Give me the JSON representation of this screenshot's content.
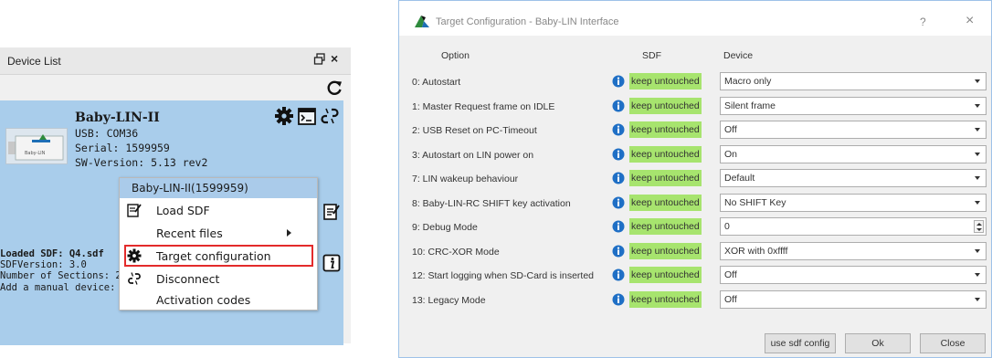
{
  "device_list": {
    "title": "Device List",
    "float_icon": "float-window-icon",
    "close_glyph": "×",
    "refresh_icon": "refresh-icon"
  },
  "device": {
    "name": "Baby-LIN-II",
    "usb": "USB: COM36",
    "serial": "Serial: 1599959",
    "sw_version": "SW-Version: 5.13 rev2",
    "thumbnail_label": "Baby-LIN",
    "card_color": "#a9cdeb"
  },
  "sdf": {
    "loaded": "Loaded SDF: Q4.sdf",
    "version": "SDFVersion: 3.0",
    "sections": "Number of Sections: 2",
    "add_manual": "Add a manual device:"
  },
  "context_menu": {
    "header": "Baby-LIN-II(1599959)",
    "items": {
      "load_sdf": "Load SDF",
      "recent_files": "Recent files",
      "target_configuration": "Target configuration",
      "disconnect": "Disconnect",
      "activation_codes": "Activation codes"
    },
    "highlight_color": "#e32b2b"
  },
  "dialog": {
    "title": "Target Configuration - Baby-LIN Interface",
    "help": "?",
    "close": "×",
    "columns": {
      "option": "Option",
      "sdf": "SDF",
      "device": "Device"
    },
    "rows": [
      {
        "label": "0:  Autostart",
        "sdf": "keep untouched",
        "device": "Macro only"
      },
      {
        "label": "1:  Master Request frame on IDLE",
        "sdf": "keep untouched",
        "device": "Silent frame"
      },
      {
        "label": "2:  USB Reset on PC-Timeout",
        "sdf": "keep untouched",
        "device": "Off"
      },
      {
        "label": "3:  Autostart on LIN power on",
        "sdf": "keep untouched",
        "device": "On"
      },
      {
        "label": "7:  LIN wakeup behaviour",
        "sdf": "keep untouched",
        "device": "Default"
      },
      {
        "label": "8:  Baby-LIN-RC SHIFT key activation",
        "sdf": "keep untouched",
        "device": "No SHIFT Key"
      },
      {
        "label": "9:  Debug Mode",
        "sdf": "keep untouched",
        "device": "0"
      },
      {
        "label": "10: CRC-XOR Mode",
        "sdf": "keep untouched",
        "device": "XOR with 0xffff"
      },
      {
        "label": "12: Start logging when SD-Card is inserted",
        "sdf": "keep untouched",
        "device": "Off"
      },
      {
        "label": "13: Legacy Mode",
        "sdf": "keep untouched",
        "device": "Off"
      }
    ],
    "buttons": {
      "use_sdf_config": "use sdf config",
      "ok": "Ok",
      "close": "Close"
    },
    "keep_untouched_color": "#a7e46e",
    "info_icon_color": "#1f6fc5"
  }
}
